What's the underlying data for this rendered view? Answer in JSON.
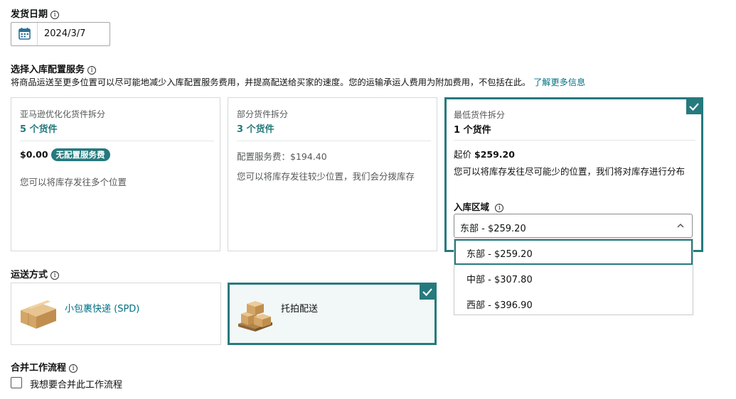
{
  "ship_date": {
    "title": "发货日期",
    "info_icon": "ⓘ",
    "value": "2024/3/7"
  },
  "placement": {
    "title": "选择入库配置服务",
    "info_icon": "ⓘ",
    "description": "将商品运送至更多位置可以尽可能地减少入库配置服务费用，并提高配送给买家的速度。您的运输承运人费用为附加费用，不包括在此。",
    "learn_more": "了解更多信息",
    "options": [
      {
        "subtitle": "亚马逊优化化货件拆分",
        "count": "5 个货件",
        "price": "$0.00",
        "badge": "无配置服务费",
        "note": "您可以将库存发往多个位置",
        "selected": false
      },
      {
        "subtitle": "部分货件拆分",
        "count": "3 个货件",
        "price": "配置服务费：$194.40",
        "note": "您可以将库存发往较少位置，我们会分拨库存",
        "selected": false
      },
      {
        "subtitle": "最低货件拆分",
        "count": "1 个货件",
        "price_prefix": "起价",
        "price": "$259.20",
        "note": "您可以将库存发往尽可能少的位置，我们将对库存进行分布",
        "selected": true
      }
    ],
    "region": {
      "label": "入库区域",
      "info_icon": "ⓘ",
      "selected": "东部 - $259.20",
      "options": [
        "东部 - $259.20",
        "中部 - $307.80",
        "西部 - $396.90"
      ]
    }
  },
  "shipping_mode": {
    "title": "运送方式",
    "info_icon": "ⓘ",
    "options": [
      {
        "label": "小包裹快递 (SPD)",
        "icon": "box-icon",
        "selected": false
      },
      {
        "label": "托拍配送",
        "icon": "pallet-icon",
        "selected": true
      }
    ]
  },
  "merge": {
    "title": "合并工作流程",
    "info_icon": "ⓘ",
    "checkbox_label": "我想要合并此工作流程",
    "checked": false
  },
  "colors": {
    "accent": "#257a7e",
    "link": "#007185",
    "border": "#d5d9d9"
  }
}
